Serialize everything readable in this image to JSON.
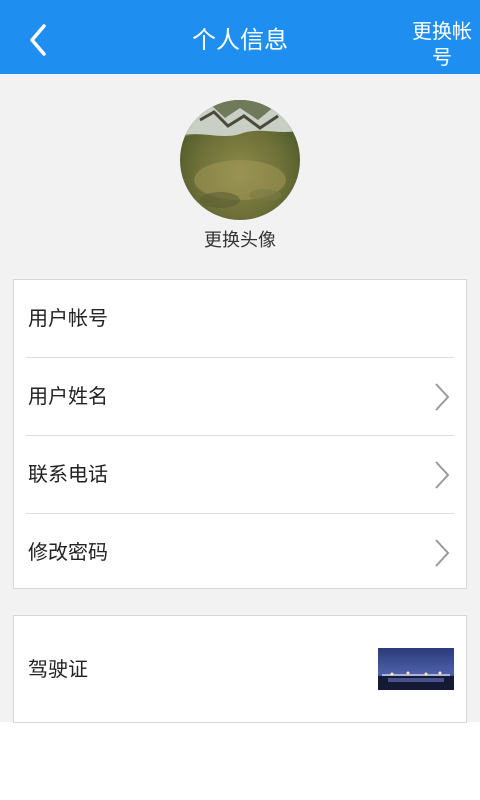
{
  "header": {
    "title": "个人信息",
    "back_icon": "chevron-left-icon",
    "switch_account_label": "更换帐号",
    "bg_color": "#1e8ff0"
  },
  "profile": {
    "change_avatar_label": "更换头像"
  },
  "info_rows": [
    {
      "label": "用户帐号",
      "has_chevron": false
    },
    {
      "label": "用户姓名",
      "has_chevron": true
    },
    {
      "label": "联系电话",
      "has_chevron": true
    },
    {
      "label": "修改密码",
      "has_chevron": true
    }
  ],
  "license": {
    "label": "驾驶证"
  }
}
